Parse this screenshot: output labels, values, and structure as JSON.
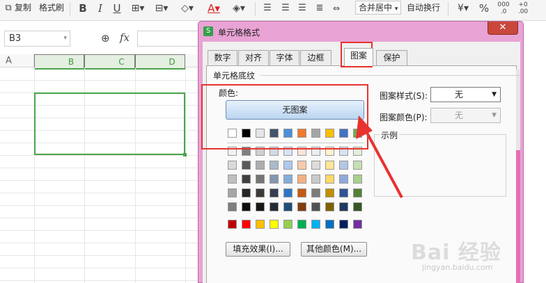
{
  "toolbar": {
    "copy_label": "复制",
    "format_painter_label": "格式刷",
    "bold_label": "B",
    "italic_label": "I",
    "underline_label": "U",
    "merge_label": "合并居中",
    "wrap_label": "自动换行",
    "percent_label": "%"
  },
  "formula_bar": {
    "cell_ref": "B3",
    "fx_label": "fx"
  },
  "sheet": {
    "columns": [
      "A",
      "B",
      "C",
      "D"
    ],
    "selected_columns": [
      "B",
      "C",
      "D"
    ]
  },
  "dialog": {
    "title": "单元格格式",
    "app_icon_glyph": "S",
    "close_glyph": "✕",
    "tabs": [
      {
        "label": "数字"
      },
      {
        "label": "对齐"
      },
      {
        "label": "字体"
      },
      {
        "label": "边框"
      },
      {
        "label": "图案",
        "active": true
      },
      {
        "label": "保护"
      }
    ],
    "group_title": "单元格底纹",
    "color_label": "颜色:",
    "no_pattern_button": "无图案",
    "fill_effects_button": "填充效果(I)...",
    "more_colors_button": "其他颜色(M)...",
    "pattern_style_label": "图案样式(S):",
    "pattern_style_value": "无",
    "pattern_color_label": "图案颜色(P):",
    "pattern_color_value": "无",
    "sample_label": "示例"
  },
  "palette": {
    "theme_row": [
      "#ffffff",
      "#000000",
      "#e6e6e6",
      "#44546a",
      "#4a8fd8",
      "#ee7a2e",
      "#a5a5a5",
      "#f8c000",
      "#4472c4",
      "#6bb046"
    ],
    "tint_rows": [
      [
        "#f2f2f2",
        "#808080",
        "#d0d0d0",
        "#d5dbe3",
        "#d6e4f6",
        "#fbe4d5",
        "#ededed",
        "#fff2cc",
        "#dae3f3",
        "#e2efd9"
      ],
      [
        "#d9d9d9",
        "#595959",
        "#aeaeae",
        "#acb9ca",
        "#adc8ee",
        "#f7caac",
        "#dbdbdb",
        "#ffe598",
        "#b4c6e7",
        "#c5e0b3"
      ],
      [
        "#bfbfbf",
        "#404040",
        "#757575",
        "#8496b0",
        "#84acde",
        "#f4b083",
        "#c9c9c9",
        "#ffd965",
        "#8eaadb",
        "#a8d08d"
      ],
      [
        "#a6a6a6",
        "#262626",
        "#3a3a3a",
        "#323f4f",
        "#2f75c4",
        "#c55a11",
        "#7b7b7b",
        "#bf9000",
        "#2f5496",
        "#538135"
      ],
      [
        "#7f7f7f",
        "#0d0d0d",
        "#171717",
        "#222a35",
        "#1f4e79",
        "#833c0b",
        "#525252",
        "#7f6000",
        "#1f3864",
        "#375623"
      ]
    ],
    "standard_row": [
      "#c00000",
      "#ff0000",
      "#ffc000",
      "#ffff00",
      "#92d050",
      "#00b050",
      "#00b0f0",
      "#0070c0",
      "#002060",
      "#7030a0"
    ]
  },
  "colors": {
    "dialog_frame": "#e9a3d4",
    "selection_green": "#4aa34a",
    "annotation_red": "#e8322f"
  },
  "watermark": {
    "text": "Bai 经验",
    "sub": "jingyan.baidu.com"
  }
}
